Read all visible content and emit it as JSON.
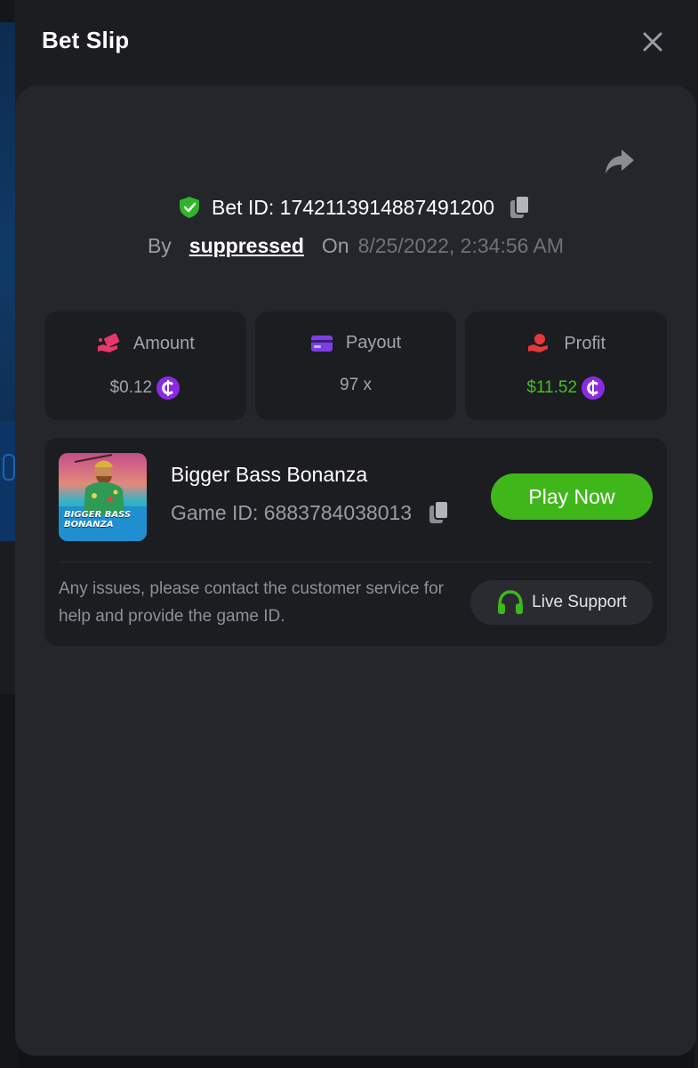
{
  "modal": {
    "title": "Bet Slip"
  },
  "bet": {
    "bet_id_label": "Bet ID: 1742113914887491200",
    "by_label": "By",
    "username": "suppressed",
    "on_label": "On",
    "date": "8/25/2022, 2:34:56 AM"
  },
  "stats": [
    {
      "label": "Amount",
      "value": "$0.12",
      "icon": "money-hand-icon",
      "has_coin": true
    },
    {
      "label": "Payout",
      "value": "97 x",
      "icon": "card-icon",
      "has_coin": false
    },
    {
      "label": "Profit",
      "value": "$11.52",
      "icon": "profit-hand-icon",
      "has_coin": true
    }
  ],
  "game": {
    "name": "Bigger Bass Bonanza",
    "game_id_label": "Game ID: 6883784038013",
    "play_button": "Play Now",
    "thumbnail_text": [
      "BIGGER BASS",
      "BONANZA"
    ]
  },
  "support": {
    "text": "Any issues, please contact the customer service for help and provide the game ID.",
    "button_label": "Live Support"
  },
  "colors": {
    "accent_green": "#3fb71b",
    "profit_green": "#43c21a",
    "coin_purple": "#8a2be2",
    "amount_pink": "#e8386b",
    "payout_purple": "#7b3fe4",
    "profit_red": "#e8383b"
  }
}
